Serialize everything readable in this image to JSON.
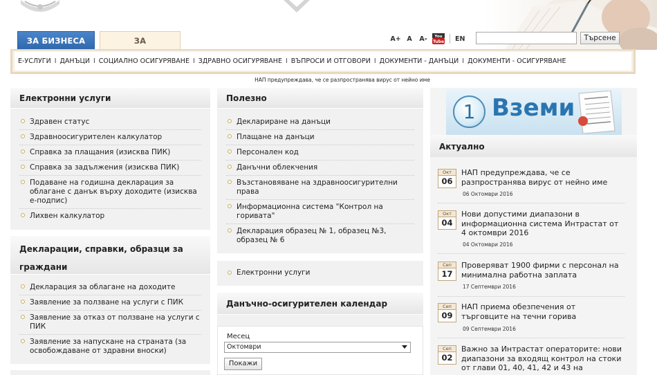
{
  "header": {
    "tabs": [
      {
        "label": "ЗА БИЗНЕСА",
        "active": false
      },
      {
        "label": "ЗА ГРАЖДАНИТЕ",
        "active": true
      }
    ],
    "font_tools": {
      "increase": "A+",
      "normal": "A",
      "decrease": "A-"
    },
    "youtube_icon": "youtube-icon",
    "language": "EN",
    "search": {
      "placeholder": "",
      "button": "Търсене"
    }
  },
  "nav": {
    "items": [
      "Е-УСЛУГИ",
      "ДАНЪЦИ",
      "СОЦИАЛНО ОСИГУРЯВАНЕ",
      "ЗДРАВНО ОСИГУРЯВАНЕ",
      "ВЪПРОСИ И ОТГОВОРИ",
      "ДОКУМЕНТИ - ДАНЪЦИ",
      "ДОКУМЕНТИ - ОСИГУРЯВАНЕ"
    ],
    "separator": "I"
  },
  "alert": "НАП предупреждава, че се разпространява вирус от нейно име",
  "left": {
    "eservices": {
      "title": "Електронни услуги",
      "items": [
        "Здравен статус",
        "Здравноосигурителен калкулатор",
        "Справка за плащания (изисква ПИК)",
        "Справка за задължения (изисква ПИК)",
        "Подаване на годишна декларация за облагане с данък върху доходите (изисква е-подпис)",
        "Лихвен калкулатор"
      ]
    },
    "declarations": {
      "title": "Декларации, справки, образци за граждани",
      "items": [
        "Декларация за облагане на доходите",
        "Заявление за ползване на услуги с ПИК",
        "Заявление за отказ от ползване на услуги с ПИК",
        "Заявление за напускане на страната (за освобождаване от здравни вноски)"
      ]
    }
  },
  "middle": {
    "useful": {
      "title": "Полезно",
      "items": [
        "Деклариране на данъци",
        "Плащане на данъци",
        "Персонален код",
        "Данъчни облекчения",
        "Възстановяване на здравноосигурителни права",
        "Информационна система \"Контрол на горивата\"",
        "Декларация образец № 1, образец №3, образец № 6"
      ]
    },
    "eservices_link": "Електронни услуги",
    "calendar": {
      "title": "Данъчно-осигурителен календар",
      "month_label": "Месец",
      "month_value": "Октомври",
      "show_button": "Покажи"
    }
  },
  "right": {
    "banner": {
      "number": "1",
      "word": "Вземи"
    },
    "current": {
      "title": "Актуално",
      "news": [
        {
          "month": "Окт",
          "day": "06",
          "title": "НАП предупреждава, че се разпространява вирус от нейно име",
          "date": "06 Октомври 2016"
        },
        {
          "month": "Окт",
          "day": "04",
          "title": "Нови допустими диапазони в информационна система Интрастат от 4 октомври 2016",
          "date": "04 Октомври 2016"
        },
        {
          "month": "Сеп",
          "day": "17",
          "title": "Проверяват 1900 фирми с персонал на минимална работна заплата",
          "date": "17 Септември 2016"
        },
        {
          "month": "Сеп",
          "day": "09",
          "title": "НАП приема обезпечения от търговците на течни горива",
          "date": "09 Септември 2016"
        },
        {
          "month": "Сеп",
          "day": "02",
          "title": "Важно за Интрастат операторите: нови диапазони за входящ контрол на стоки от глави 01, 40, 41, 42 и 43 на",
          "date": ""
        }
      ]
    }
  },
  "colors": {
    "accent_blue": "#2f68ad",
    "nav_border": "#e8d8bd",
    "panel_bg": "#f1f1f1"
  }
}
